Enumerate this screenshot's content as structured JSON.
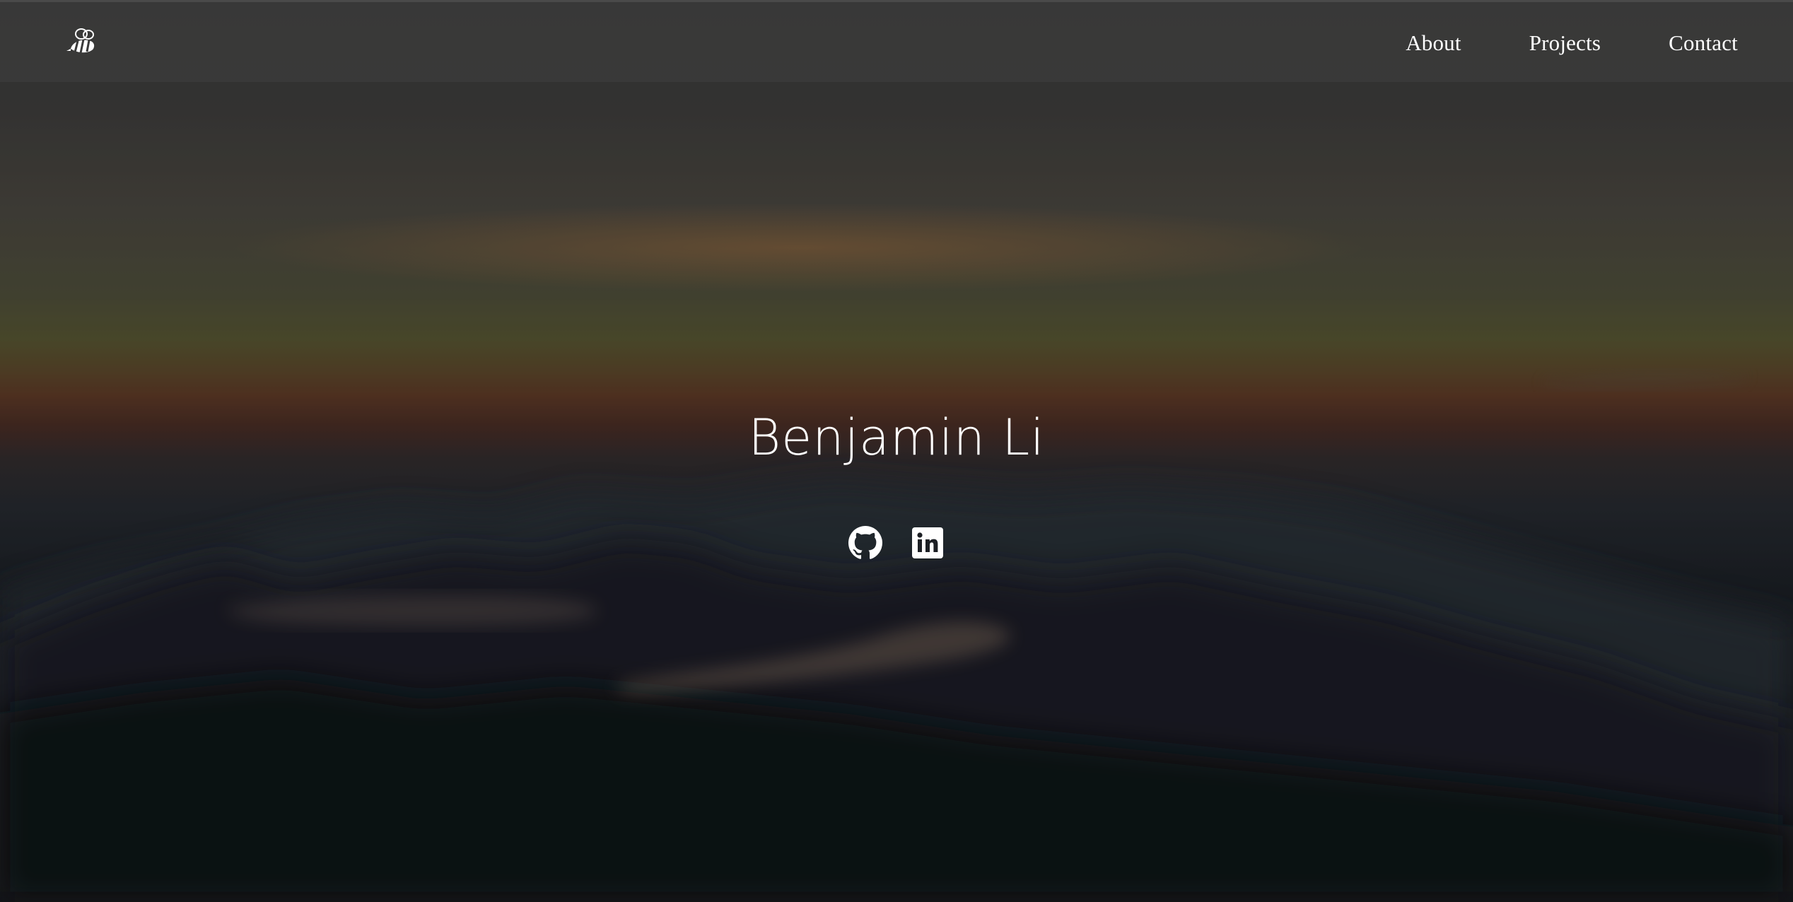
{
  "header": {
    "logo_icon": "bee-icon",
    "nav": [
      {
        "label": "About"
      },
      {
        "label": "Projects"
      },
      {
        "label": "Contact"
      }
    ]
  },
  "hero": {
    "name": "Benjamin Li",
    "social": [
      {
        "icon": "github-icon"
      },
      {
        "icon": "linkedin-icon"
      }
    ]
  },
  "colors": {
    "nav_bg": "#3a3a3a",
    "text": "#ffffff"
  }
}
